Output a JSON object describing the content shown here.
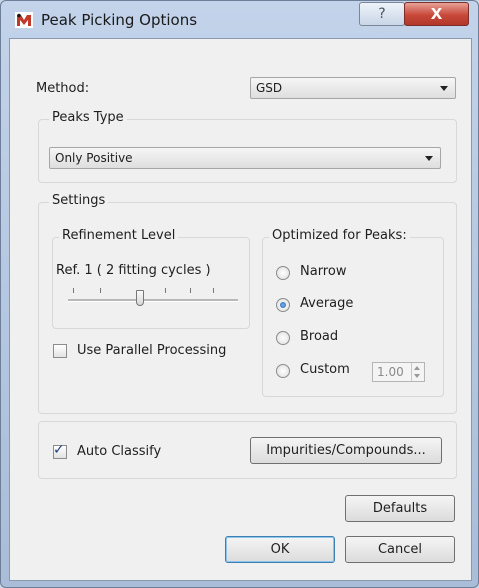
{
  "window": {
    "title": "Peak Picking Options",
    "help_icon": "?",
    "close_icon": "X"
  },
  "method": {
    "label": "Method:",
    "value": "GSD"
  },
  "peaks_type": {
    "title": "Peaks Type",
    "value": "Only Positive"
  },
  "settings": {
    "title": "Settings",
    "refinement": {
      "title": "Refinement Level",
      "text": "Ref. 1 ( 2 fitting cycles )"
    },
    "use_parallel_label": "Use Parallel Processing",
    "optimized": {
      "title": "Optimized for Peaks:",
      "options": [
        "Narrow",
        "Average",
        "Broad",
        "Custom"
      ],
      "selected": "Average",
      "custom_value": "1.00"
    }
  },
  "auto_classify_label": "Auto Classify",
  "buttons": {
    "impurities": "Impurities/Compounds...",
    "defaults": "Defaults",
    "ok": "OK",
    "cancel": "Cancel"
  },
  "colors": {
    "accent": "#1f5aa8",
    "close_button": "#c8493a"
  }
}
